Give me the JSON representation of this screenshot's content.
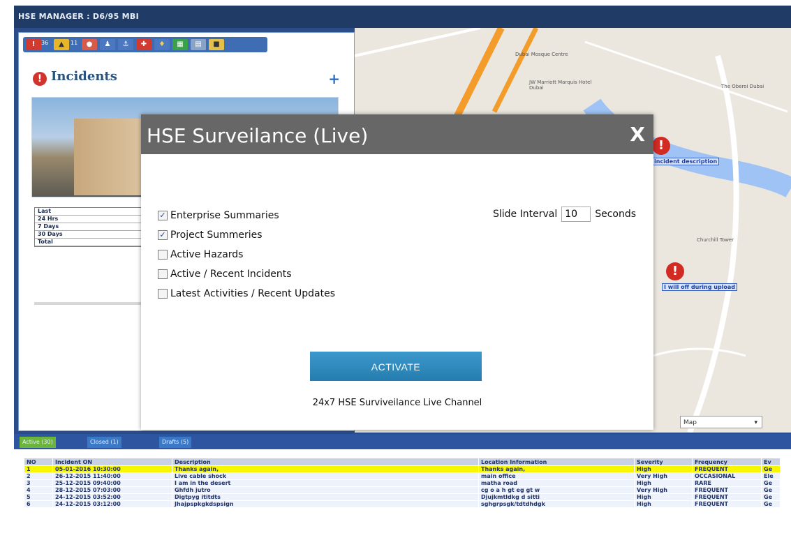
{
  "app": {
    "title": "HSE MANAGER : D6/95 MBI"
  },
  "left_panel": {
    "section_title": "Incidents",
    "add_label": "+",
    "stats_rows": [
      "Last",
      "24 Hrs",
      "7 Days",
      "30 Days",
      "Total"
    ],
    "toolbar_badges": [
      "36",
      "11"
    ]
  },
  "map": {
    "labels": [
      "Dubai Mosque Centre",
      "JW Marriott Marquis Hotel Dubai",
      "Churchill Tower",
      "The Oberoi Dubai"
    ],
    "marker_label_1": "incident description",
    "marker_label_2": "I will off during upload",
    "type_select": "Map"
  },
  "bottom_tabs": [
    "Active (30)",
    "Closed (1)",
    "Drafts (5)"
  ],
  "table": {
    "headers": [
      "NO",
      "Incident ON",
      "Description",
      "Location Information",
      "Severity",
      "Frequency",
      "Ev"
    ],
    "rows": [
      [
        "1",
        "05-01-2016 10:30:00",
        "Thanks again,",
        "Thanks again,",
        "High",
        "FREQUENT",
        "Ge"
      ],
      [
        "2",
        "26-12-2015 11:40:00",
        "Live cable shock",
        "main office",
        "Very High",
        "OCCASIONAL",
        "Ele"
      ],
      [
        "3",
        "25-12-2015 09:40:00",
        "I am in the desert",
        "matha road",
        "High",
        "RARE",
        "Ge"
      ],
      [
        "4",
        "28-12-2015 07:03:00",
        "Ghfdh jutro",
        "cg o a h gt eg gt w",
        "Very High",
        "FREQUENT",
        "Ge"
      ],
      [
        "5",
        "24-12-2015 03:52:00",
        "Digtpyg ititdts",
        "Djujkmtldkg d sitti",
        "High",
        "FREQUENT",
        "Ge"
      ],
      [
        "6",
        "24-12-2015 03:12:00",
        "Jhajpspkgkdspsign",
        "sghgrpsgk/tdtdhdgk",
        "High",
        "FREQUENT",
        "Ge"
      ]
    ]
  },
  "modal": {
    "title": "HSE Surveilance (Live)",
    "close_label": "X",
    "options": [
      {
        "label": "Enterprise Summaries",
        "checked": "✓"
      },
      {
        "label": "Project Summeries",
        "checked": "✓"
      },
      {
        "label": "Active Hazards",
        "checked": ""
      },
      {
        "label": "Active / Recent Incidents",
        "checked": ""
      },
      {
        "label": "Latest Activities / Recent Updates",
        "checked": ""
      }
    ],
    "slide_label": "Slide Interval",
    "slide_value": "10",
    "slide_unit": "Seconds",
    "activate_label": "ACTIVATE",
    "channel_text": "24x7 HSE Surviveilance Live Channel"
  }
}
